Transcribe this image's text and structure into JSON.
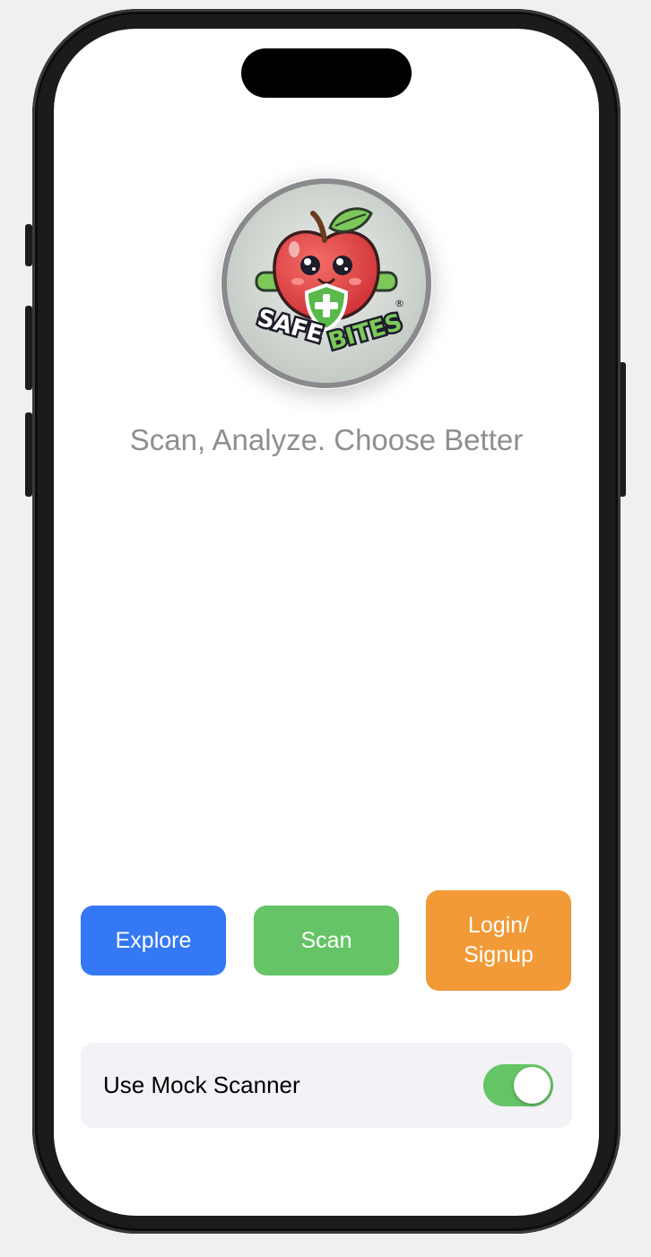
{
  "app": {
    "logo_name": "SafeBites",
    "tagline": "Scan, Analyze. Choose Better"
  },
  "logo": {
    "wordmark_left": "SAFE",
    "wordmark_right": "BITES",
    "registered_mark": "®"
  },
  "buttons": {
    "explore": "Explore",
    "scan": "Scan",
    "login": "Login/\nSignup"
  },
  "settings": {
    "mock_scanner_label": "Use Mock Scanner",
    "mock_scanner_on": true
  },
  "colors": {
    "explore": "#3478f6",
    "scan": "#65c466",
    "login": "#f19a37",
    "toggle_on": "#65c466",
    "tagline": "#8e8e93"
  },
  "icons": [
    "shield-plus-icon",
    "apple-mascot-icon"
  ]
}
